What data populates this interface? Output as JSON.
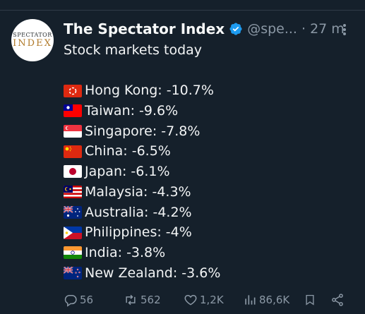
{
  "author": {
    "name": "The Spectator Index",
    "handle": "@spe...",
    "time": "· 27 m",
    "avatar_line1": "SPECTATOR",
    "avatar_line2": "INDEX"
  },
  "post": {
    "headline": "Stock markets today",
    "items": [
      {
        "flag": "hong-kong-flag",
        "text": "Hong Kong: -10.7%"
      },
      {
        "flag": "taiwan-flag",
        "text": "Taiwan: -9.6%"
      },
      {
        "flag": "singapore-flag",
        "text": "Singapore: -7.8%"
      },
      {
        "flag": "china-flag",
        "text": "China: -6.5%"
      },
      {
        "flag": "japan-flag",
        "text": "Japan: -6.1%"
      },
      {
        "flag": "malaysia-flag",
        "text": "Malaysia: -4.3%"
      },
      {
        "flag": "australia-flag",
        "text": "Australia: -4.2%"
      },
      {
        "flag": "philippines-flag",
        "text": "Philippines: -4%"
      },
      {
        "flag": "india-flag",
        "text": "India: -3.8%"
      },
      {
        "flag": "new-zealand-flag",
        "text": "New Zealand: -3.6%"
      }
    ]
  },
  "actions": {
    "replies": "56",
    "reposts": "562",
    "likes": "1,2K",
    "views": "86,6K"
  },
  "colors": {
    "background": "#15202b",
    "text": "#f7f9f9",
    "muted": "#8b98a5",
    "verified": "#1d9bf0"
  }
}
